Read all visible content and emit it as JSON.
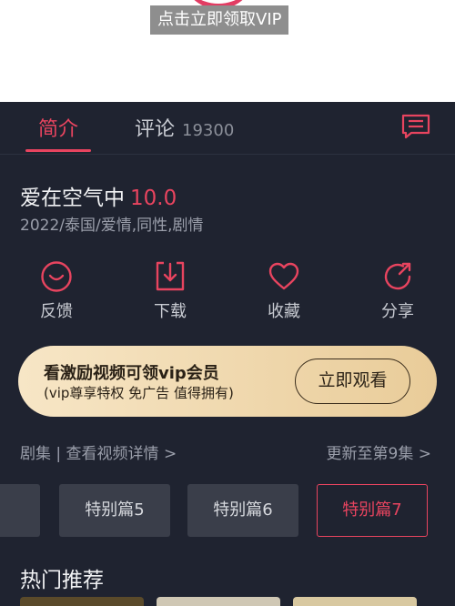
{
  "header": {
    "vip_tip": "点击立即领取VIP"
  },
  "tabs": {
    "intro": "简介",
    "comments": "评论",
    "comment_count": "19300",
    "menu_icon": "list-icon"
  },
  "show": {
    "title": "爱在空气中",
    "score": "10.0",
    "meta": "2022/泰国/爱情,同性,剧情"
  },
  "actions": [
    {
      "label": "反馈",
      "icon": "feedback-icon"
    },
    {
      "label": "下载",
      "icon": "download-icon"
    },
    {
      "label": "收藏",
      "icon": "heart-icon"
    },
    {
      "label": "分享",
      "icon": "share-icon"
    }
  ],
  "banner": {
    "title": "看激励视频可领vip会员",
    "subtitle": "(vip尊享特权 免广告 值得拥有)",
    "button": "立即观看"
  },
  "episodes": {
    "link": "剧集 | 查看视频详情 >",
    "update": "更新至第9集 >",
    "items": [
      "特别篇5",
      "特别篇6",
      "特别篇7"
    ]
  },
  "recommend": {
    "title": "热门推荐"
  },
  "colors": {
    "accent": "#e8445f",
    "panel_bg": "#1f2330",
    "banner_gold": "#e9cc99"
  }
}
